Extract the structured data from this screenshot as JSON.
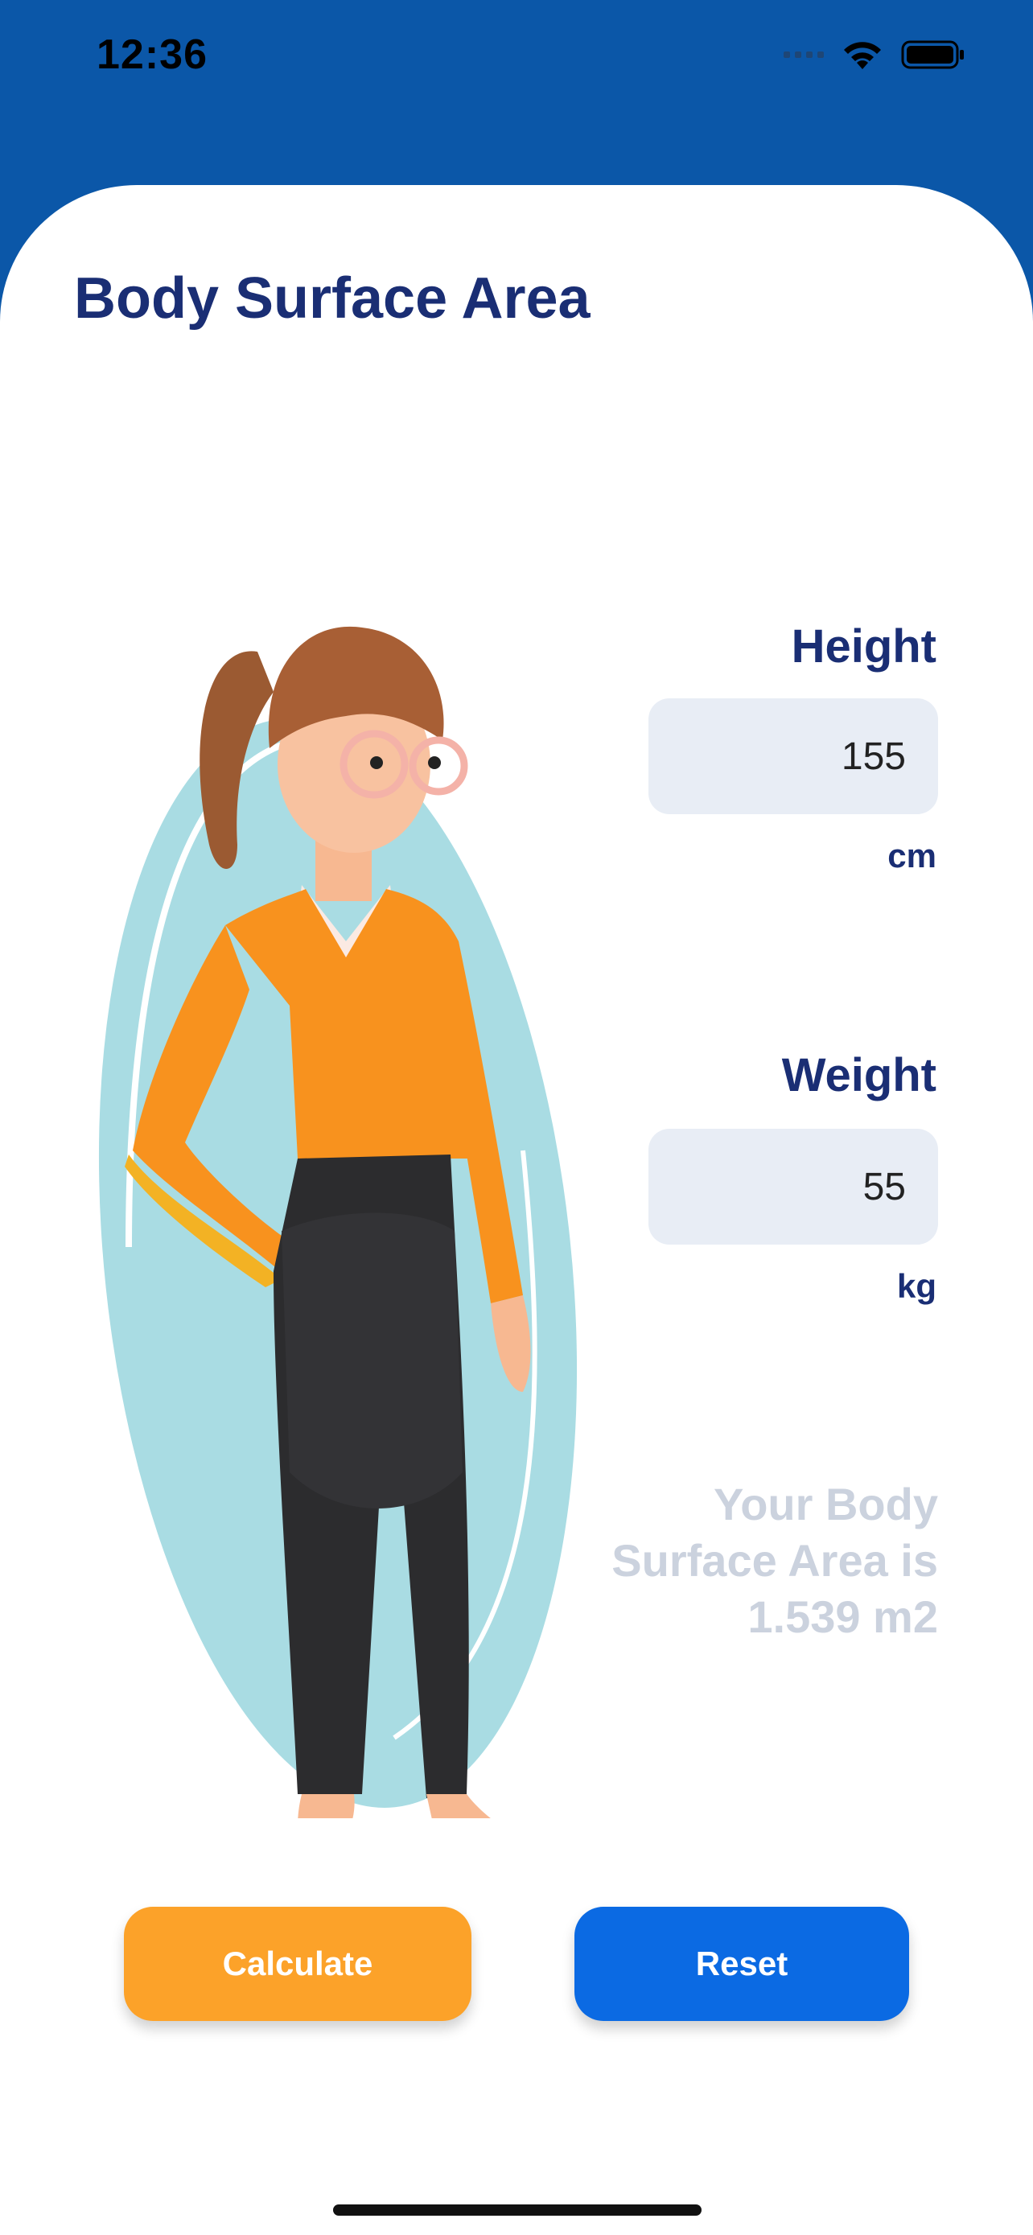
{
  "status_bar": {
    "time": "12:36",
    "signal_icon": "cellular-signal-icon",
    "wifi_icon": "wifi-icon",
    "battery_icon": "battery-icon"
  },
  "header": {
    "title": "Body Surface Area"
  },
  "illustration": {
    "name": "woman-standing-illustration",
    "blob_color": "#A9DCE3",
    "shirt_color": "#F8921E",
    "pants_color": "#2C2C2E"
  },
  "form": {
    "height": {
      "label": "Height",
      "value": "155",
      "unit": "cm"
    },
    "weight": {
      "label": "Weight",
      "value": "55",
      "unit": "kg"
    }
  },
  "result": {
    "text": "Your Body Surface Area is 1.539 m2"
  },
  "buttons": {
    "calculate": "Calculate",
    "reset": "Reset"
  },
  "colors": {
    "header_bg": "#0B57A8",
    "title": "#1A2E74",
    "calculate": "#FCA229",
    "reset": "#0B6AE3",
    "field_bg": "#E8EDF5",
    "result_text": "#CBD2DE"
  }
}
